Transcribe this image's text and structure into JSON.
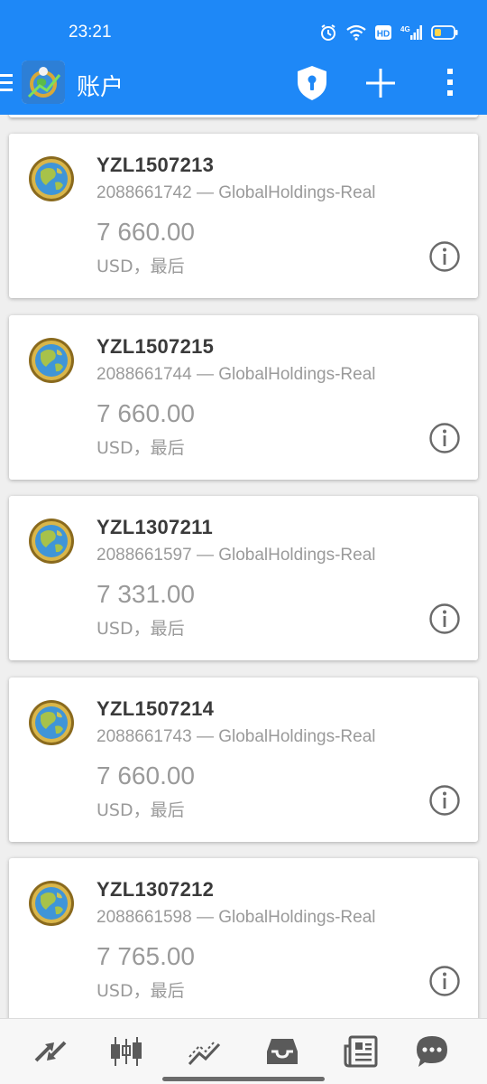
{
  "status_bar": {
    "time": "23:21",
    "icons": [
      "alarm-icon",
      "wifi-icon",
      "hd-icon",
      "signal-4g-icon",
      "battery-icon"
    ],
    "hd_label": "HD",
    "network_label": "4G"
  },
  "app_bar": {
    "title": "账户",
    "icons": [
      "menu-icon",
      "app-logo",
      "shield-lock-icon",
      "plus-icon",
      "more-vertical-icon"
    ]
  },
  "accounts": [
    {
      "name": "YZL1507213",
      "server": "2088661742 — GlobalHoldings-Real",
      "balance": "7 660.00",
      "currency": "USD，最后"
    },
    {
      "name": "YZL1507215",
      "server": "2088661744 — GlobalHoldings-Real",
      "balance": "7 660.00",
      "currency": "USD，最后"
    },
    {
      "name": "YZL1307211",
      "server": "2088661597 — GlobalHoldings-Real",
      "balance": "7 331.00",
      "currency": "USD，最后"
    },
    {
      "name": "YZL1507214",
      "server": "2088661743 — GlobalHoldings-Real",
      "balance": "7 660.00",
      "currency": "USD，最后"
    },
    {
      "name": "YZL1307212",
      "server": "2088661598 — GlobalHoldings-Real",
      "balance": "7 765.00",
      "currency": "USD，最后"
    }
  ],
  "bottom_nav": {
    "items": [
      "quotes-arrows-icon",
      "candlestick-chart-icon",
      "trade-chart-icon",
      "inbox-history-icon",
      "news-icon",
      "chat-icon"
    ]
  },
  "colors": {
    "header_bg": "#1e88f7",
    "text_dark": "#3a3a3a",
    "text_muted": "#9a9a9a",
    "icon_gray": "#5a5a5a"
  }
}
